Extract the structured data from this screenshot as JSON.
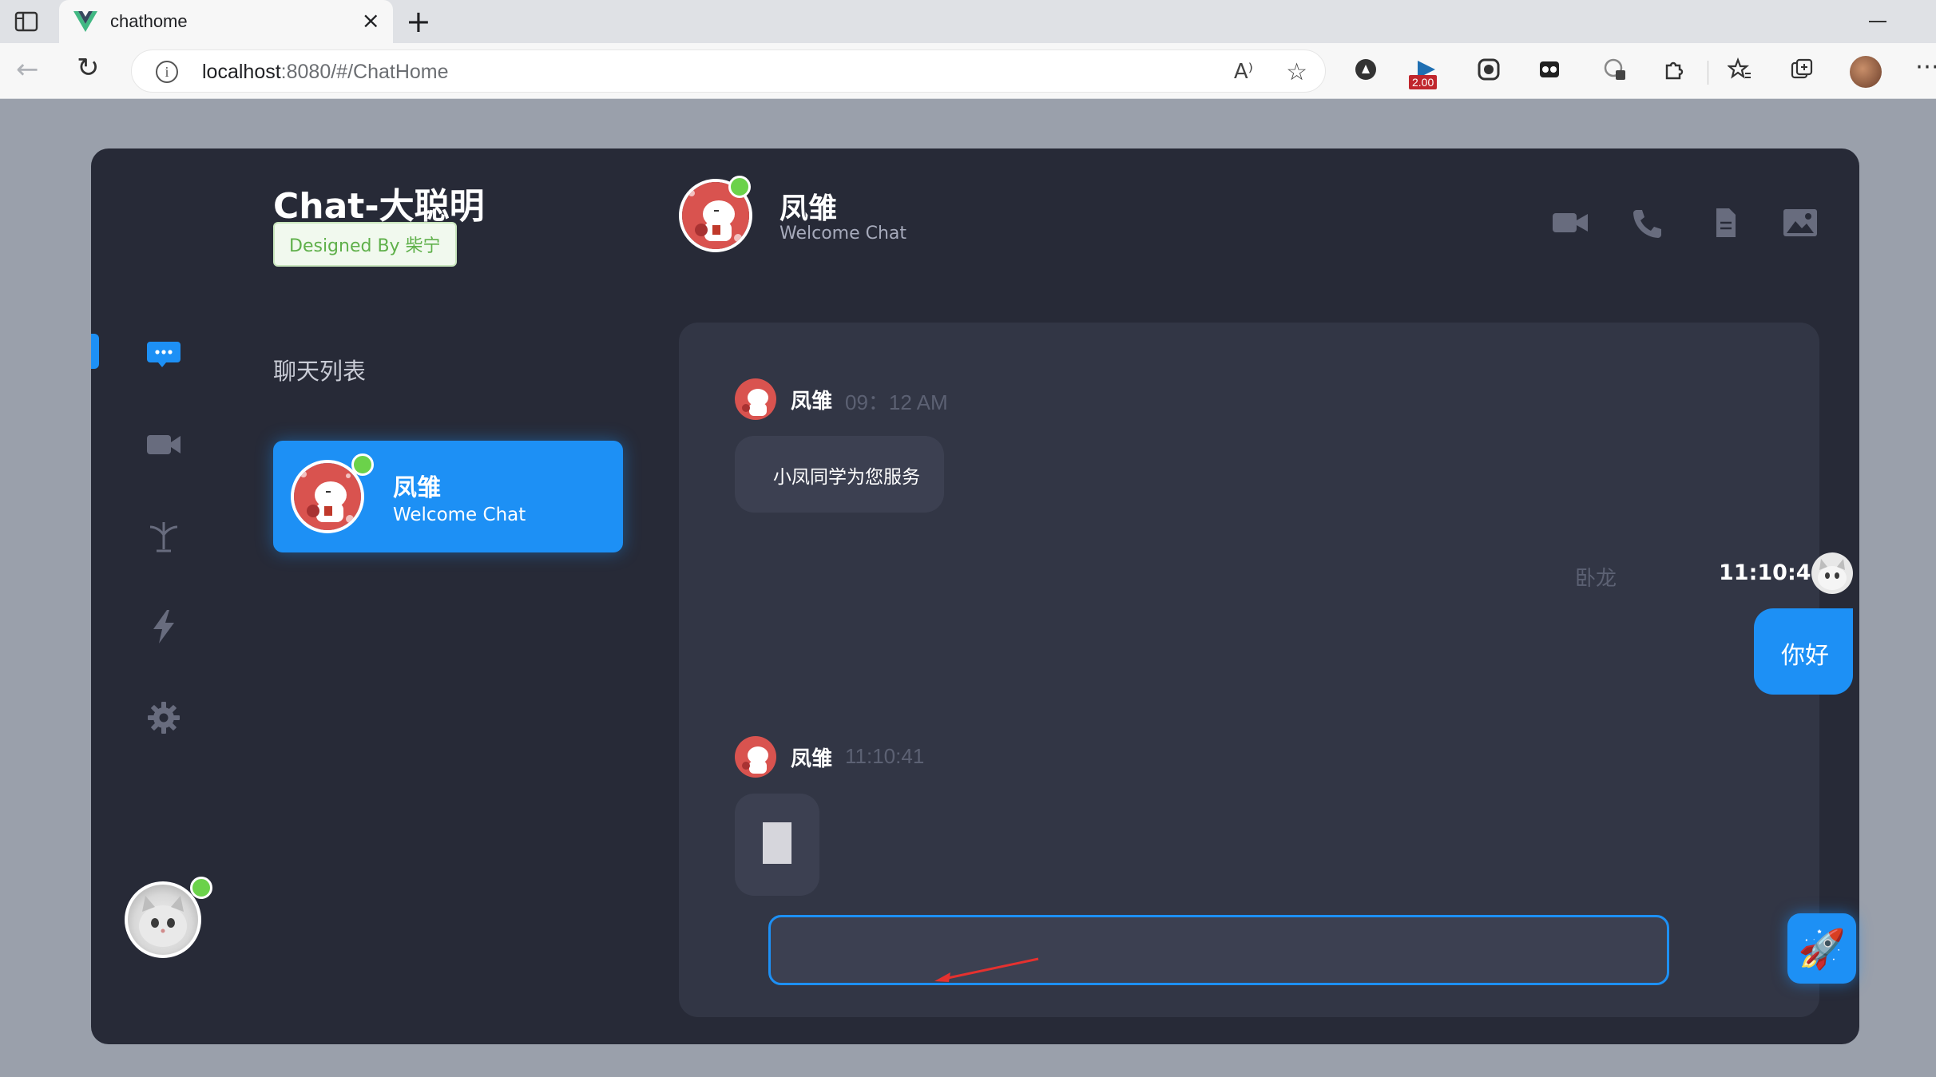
{
  "browser": {
    "tab_title": "chathome",
    "new_tab": "+",
    "close": "×",
    "url_host": "localhost",
    "url_rest": ":8080/#/ChatHome",
    "ext_badge": "2.00"
  },
  "app": {
    "brand_title": "Chat-大聪明",
    "brand_badge": "Designed By 柴宁",
    "list_title": "聊天列表",
    "nav_items": [
      "chat-icon",
      "video-icon",
      "plant-icon",
      "lightning-icon",
      "gear-icon"
    ],
    "active_nav": "chat-icon",
    "chat_list": [
      {
        "name": "凤雏",
        "subtitle": "Welcome Chat",
        "online": true,
        "active": true
      }
    ],
    "header": {
      "name": "凤雏",
      "subtitle": "Welcome Chat",
      "actions": [
        "video-call-icon",
        "phone-icon",
        "document-icon",
        "image-icon"
      ]
    },
    "messages": [
      {
        "from": "凤雏",
        "time": "09：12 AM",
        "text": "小凤同学为您服务",
        "direction": "in"
      },
      {
        "from": "卧龙",
        "time": "11:10:41",
        "text": "你好",
        "direction": "out"
      },
      {
        "from": "凤雏",
        "time": "11:10:41",
        "text": "",
        "direction": "in"
      }
    ],
    "composer": {
      "value": "",
      "send_icon": "🚀"
    }
  },
  "colors": {
    "accent": "#1d90f5",
    "online": "#6bd24a",
    "app_bg": "#272a37",
    "panel_bg": "#323645",
    "bubble_in": "#3c4051"
  }
}
